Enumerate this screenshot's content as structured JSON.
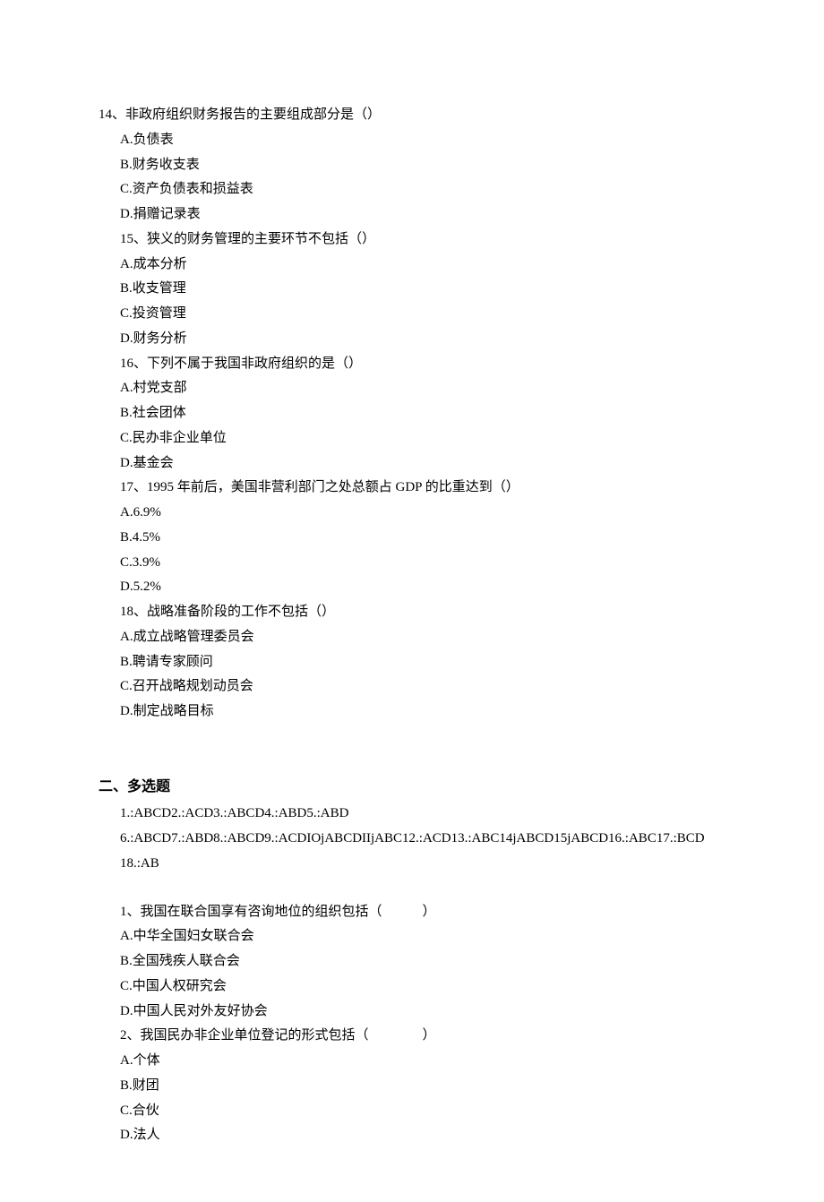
{
  "q14": {
    "stem": "14、非政府组织财务报告的主要组成部分是（）",
    "A": "A.负债表",
    "B": "B.财务收支表",
    "C": "C.资产负债表和损益表",
    "D": "D.捐赠记录表"
  },
  "q15": {
    "stem": "15、狭义的财务管理的主要环节不包括（）",
    "A": "A.成本分析",
    "B": "B.收支管理",
    "C": "C.投资管理",
    "D": "D.财务分析"
  },
  "q16": {
    "stem": "16、下列不属于我国非政府组织的是（）",
    "A": "A.村党支部",
    "B": "B.社会团体",
    "C": "C.民办非企业单位",
    "D": "D.基金会"
  },
  "q17": {
    "stem": "17、1995 年前后，美国非营利部门之处总额占 GDP 的比重达到（）",
    "A": "A.6.9%",
    "B": "B.4.5%",
    "C": "C.3.9%",
    "D": "D.5.2%"
  },
  "q18": {
    "stem": "18、战略准备阶段的工作不包括（）",
    "A": "A.成立战略管理委员会",
    "B": "B.聘请专家顾问",
    "C": "C.召开战略规划动员会",
    "D": "D.制定战略目标"
  },
  "section2_title": "二、多选题",
  "answers_line1": "1.:ABCD2.:ACD3.:ABCD4.:ABD5.:ABD",
  "answers_line2": "6.:ABCD7.:ABD8.:ABCD9.:ACDIOjABCDIIjABC12.:ACD13.:ABC14jABCD15jABCD16.:ABC17.:BCD",
  "answers_line3": "18.:AB",
  "mq1": {
    "stem": "1、我国在联合国享有咨询地位的组织包括（　　　）",
    "A": "A.中华全国妇女联合会",
    "B": "B.全国残疾人联合会",
    "C": "C.中国人权研究会",
    "D": "D.中国人民对外友好协会"
  },
  "mq2": {
    "stem": "2、我国民办非企业单位登记的形式包括（　　　　）",
    "A": "A.个体",
    "B": "B.财团",
    "C": "C.合伙",
    "D": "D.法人"
  }
}
